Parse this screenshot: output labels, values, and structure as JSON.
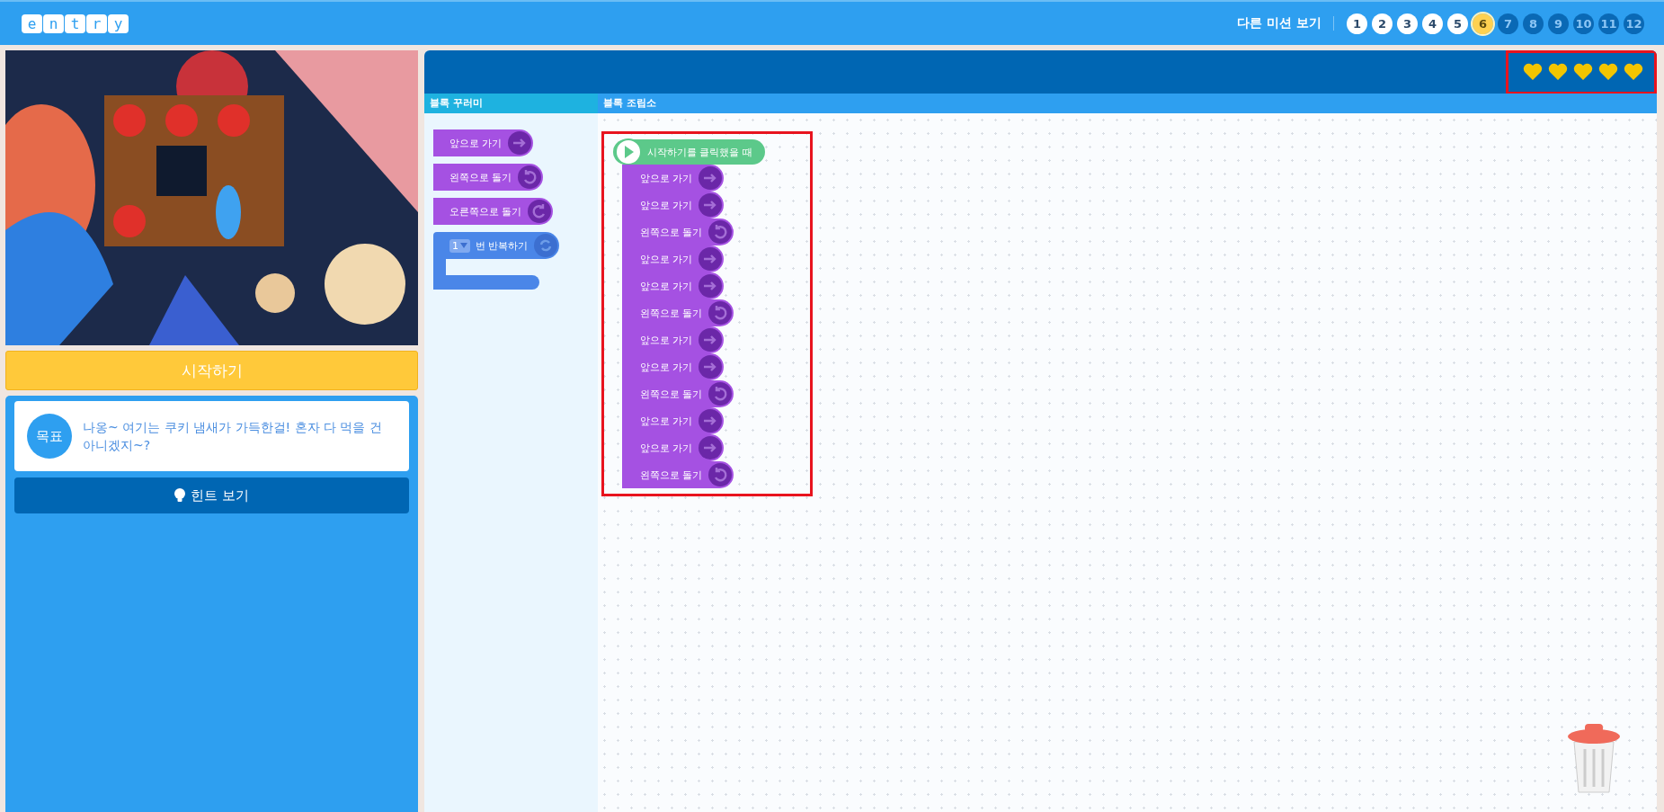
{
  "header": {
    "logo_letters": [
      "e",
      "n",
      "t",
      "r",
      "y"
    ],
    "other_missions_label": "다른 미션 보기",
    "missions": [
      {
        "label": "1",
        "selected": false,
        "locked": false
      },
      {
        "label": "2",
        "selected": false,
        "locked": false
      },
      {
        "label": "3",
        "selected": false,
        "locked": false
      },
      {
        "label": "4",
        "selected": false,
        "locked": false
      },
      {
        "label": "5",
        "selected": false,
        "locked": false
      },
      {
        "label": "6",
        "selected": true,
        "locked": false
      },
      {
        "label": "7",
        "selected": false,
        "locked": true
      },
      {
        "label": "8",
        "selected": false,
        "locked": true
      },
      {
        "label": "9",
        "selected": false,
        "locked": true
      },
      {
        "label": "10",
        "selected": false,
        "locked": true
      },
      {
        "label": "11",
        "selected": false,
        "locked": true
      },
      {
        "label": "12",
        "selected": false,
        "locked": true
      }
    ]
  },
  "start_button": "시작하기",
  "goal": {
    "badge": "목표",
    "text": "나옹~ 여기는 쿠키 냄새가 가득한걸! 혼자 다 먹을 건 아니겠지~?"
  },
  "hint_button": "힌트 보기",
  "lives": {
    "stars": 5
  },
  "palette": {
    "title": "블록 꾸러미",
    "blocks": [
      {
        "kind": "forward",
        "label": "앞으로 가기"
      },
      {
        "kind": "turn_left",
        "label": "왼쪽으로 돌기"
      },
      {
        "kind": "turn_right",
        "label": "오른쪽으로 돌기"
      },
      {
        "kind": "repeat",
        "count": "1",
        "label": "번 반복하기"
      }
    ]
  },
  "workspace": {
    "title": "블록 조립소",
    "trigger": "시작하기를 클릭했을 때",
    "blocks": [
      {
        "kind": "forward",
        "label": "앞으로 가기"
      },
      {
        "kind": "forward",
        "label": "앞으로 가기"
      },
      {
        "kind": "turn_left",
        "label": "왼쪽으로 돌기"
      },
      {
        "kind": "forward",
        "label": "앞으로 가기"
      },
      {
        "kind": "forward",
        "label": "앞으로 가기"
      },
      {
        "kind": "turn_left",
        "label": "왼쪽으로 돌기"
      },
      {
        "kind": "forward",
        "label": "앞으로 가기"
      },
      {
        "kind": "forward",
        "label": "앞으로 가기"
      },
      {
        "kind": "turn_left",
        "label": "왼쪽으로 돌기"
      },
      {
        "kind": "forward",
        "label": "앞으로 가기"
      },
      {
        "kind": "forward",
        "label": "앞으로 가기"
      },
      {
        "kind": "turn_left",
        "label": "왼쪽으로 돌기"
      }
    ]
  }
}
